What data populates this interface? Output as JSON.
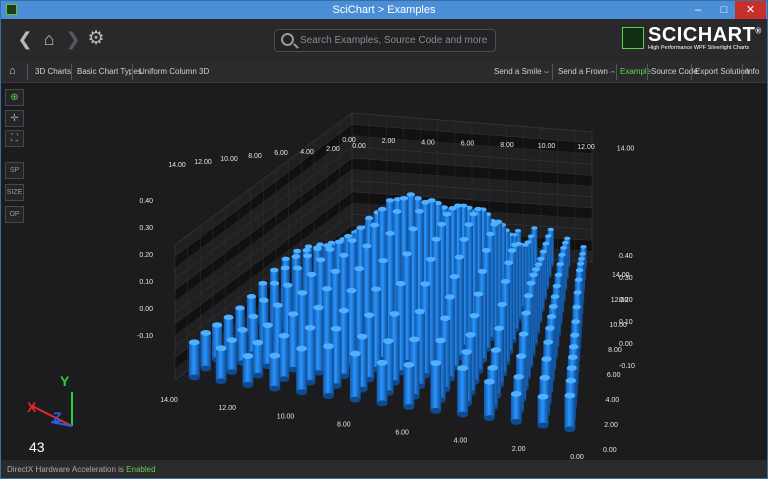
{
  "window": {
    "title": "SciChart > Examples",
    "minimize": "–",
    "maximize": "□",
    "close": "✕"
  },
  "header": {
    "back_icon": "chevron-left-icon",
    "home_icon": "home-icon",
    "forward_icon": "chevron-right-icon",
    "settings_icon": "gear-icon",
    "search_placeholder": "Search Examples, Source Code and more ...",
    "logo_text": "SCICHART",
    "logo_sub": "High Performance WPF Silverlight Charts",
    "logo_reg": "®"
  },
  "breadcrumb": {
    "items": [
      "3D Charts",
      "Basic Chart Types",
      "Uniform Column 3D"
    ]
  },
  "actions": {
    "smile": "Send a Smile",
    "frown": "Send a Frown",
    "example": "Example",
    "source": "Source Code",
    "export": "Export Solution",
    "info": "Info"
  },
  "toolbar": {
    "b1": "SP",
    "b2": "SIZE",
    "b3": "OP"
  },
  "fps": "43",
  "status": {
    "prefix": "DirectX Hardware Acceleration is ",
    "state": "Enabled"
  },
  "chart_data": {
    "type": "column-3d",
    "column_color": "#1e90ff",
    "x_ticks": [
      "0.00",
      "2.00",
      "4.00",
      "6.00",
      "8.00",
      "10.00",
      "12.00",
      "14.00"
    ],
    "z_ticks": [
      "0.00",
      "2.00",
      "4.00",
      "6.00",
      "8.00",
      "10.00",
      "12.00",
      "14.00"
    ],
    "y_ticks": [
      "-0.10",
      "0.00",
      "0.10",
      "0.20",
      "0.30",
      "0.40"
    ],
    "y_ticks_right": [
      "-0.10",
      "0.00",
      "0.10",
      "0.20",
      "0.30",
      "0.40"
    ],
    "top_x_ticks": [
      "14.00",
      "12.00",
      "10.00",
      "8.00",
      "6.00",
      "4.00",
      "2.00",
      "0.00"
    ],
    "top_z_ticks": [
      "0.00",
      "2.00",
      "4.00",
      "6.00",
      "8.00",
      "10.00",
      "12.00",
      "14.00"
    ],
    "axis_labels": {
      "y": "Y",
      "x": "X",
      "z": "Z"
    },
    "ylim": [
      -0.1,
      0.45
    ]
  }
}
